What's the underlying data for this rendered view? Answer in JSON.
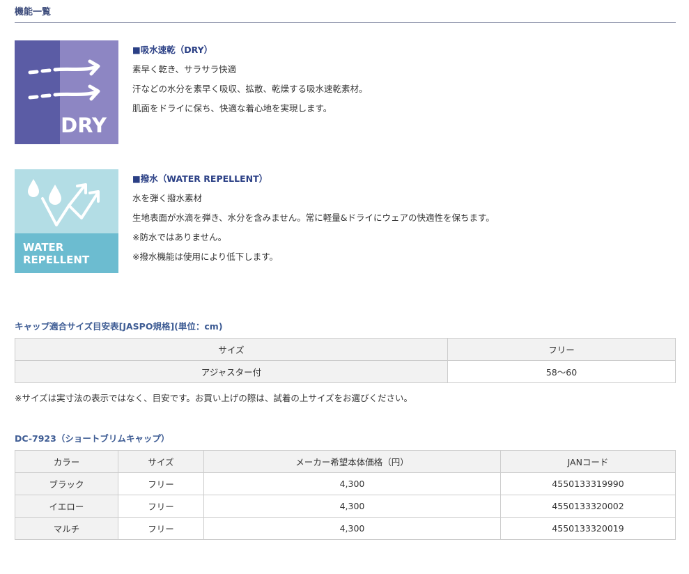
{
  "section_title": "機能一覧",
  "features": [
    {
      "icon": "dry-icon",
      "badge": "DRY",
      "heading": "■吸水速乾（DRY）",
      "lines": [
        "素早く乾き、サラサラ快適",
        "汗などの水分を素早く吸収、拡散、乾燥する吸水速乾素材。",
        "肌面をドライに保ち、快適な着心地を実現します。"
      ]
    },
    {
      "icon": "water-repellent-icon",
      "badge_line1": "WATER",
      "badge_line2": "REPELLENT",
      "heading": "■撥水（WATER REPELLENT）",
      "lines": [
        "水を弾く撥水素材",
        "生地表面が水滴を弾き、水分を含みません。常に軽量&ドライにウェアの快適性を保ちます。",
        "※防水ではありません。",
        "※撥水機能は使用により低下します。"
      ]
    }
  ],
  "size_table": {
    "title": "キャップ適合サイズ目安表[JASPO規格](単位：cm)",
    "headers": [
      "サイズ",
      "フリー"
    ],
    "rows": [
      [
        "アジャスター付",
        "58〜60"
      ]
    ],
    "note": "※サイズは実寸法の表示ではなく、目安です。お買い上げの際は、試着の上サイズをお選びください。"
  },
  "product_table": {
    "title": "DC-7923（ショートブリムキャップ）",
    "headers": [
      "カラー",
      "サイズ",
      "メーカー希望本体価格（円）",
      "JANコード"
    ],
    "rows": [
      [
        "ブラック",
        "フリー",
        "4,300",
        "4550133319990"
      ],
      [
        "イエロー",
        "フリー",
        "4,300",
        "4550133320002"
      ],
      [
        "マルチ",
        "フリー",
        "4,300",
        "4550133320019"
      ]
    ]
  },
  "colors": {
    "dry_dark": "#5b5ca5",
    "dry_light": "#8d86c3",
    "water_light": "#b3dde5",
    "water_dark": "#6cbcd0",
    "heading_blue": "#2a3f85"
  }
}
